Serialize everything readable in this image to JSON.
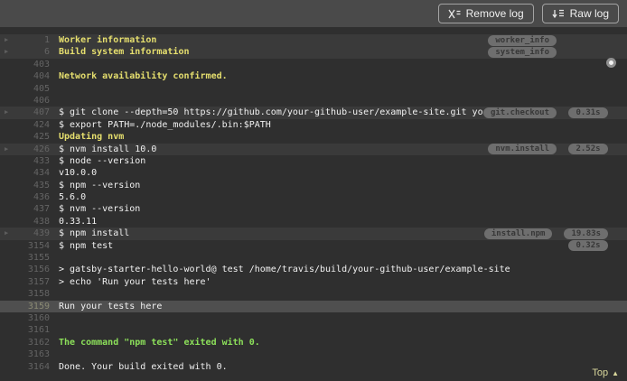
{
  "toolbar": {
    "remove_log_label": "Remove log",
    "raw_log_label": "Raw log"
  },
  "colors": {
    "header_bg": "#4a4a4a",
    "log_bg": "#2f2f2f",
    "row_highlight": "#3a3a3a",
    "row_selected": "#4f4f4f",
    "text_yellow": "#e6df6e",
    "text_green": "#8ce05a",
    "text_default": "#f1f1f1",
    "pill_bg": "#6e6e6e",
    "top_link": "#d9d79c"
  },
  "log": {
    "top_link_label": "Top",
    "rows": [
      {
        "line": "1",
        "text": "Worker information",
        "color": "yellow",
        "fold": true,
        "highlight": true,
        "tag": "worker_info"
      },
      {
        "line": "6",
        "text": "Build system information",
        "color": "yellow",
        "fold": true,
        "highlight": true,
        "tag": "system_info"
      },
      {
        "line": "403",
        "text": ""
      },
      {
        "line": "404",
        "text": "Network availability confirmed.",
        "color": "yellow"
      },
      {
        "line": "405",
        "text": ""
      },
      {
        "line": "406",
        "text": ""
      },
      {
        "line": "407",
        "text": "$ git clone --depth=50 https://github.com/your-github-user/example-site.git your-github-user/example-",
        "fold": true,
        "highlight": true,
        "tag": "git.checkout",
        "duration": "0.31s"
      },
      {
        "line": "424",
        "text": "$ export PATH=./node_modules/.bin:$PATH"
      },
      {
        "line": "425",
        "text": "Updating nvm",
        "color": "yellow"
      },
      {
        "line": "426",
        "text": "$ nvm install 10.0",
        "fold": true,
        "highlight": true,
        "tag": "nvm.install",
        "duration": "2.52s"
      },
      {
        "line": "433",
        "text": "$ node --version"
      },
      {
        "line": "434",
        "text": "v10.0.0"
      },
      {
        "line": "435",
        "text": "$ npm --version"
      },
      {
        "line": "436",
        "text": "5.6.0"
      },
      {
        "line": "437",
        "text": "$ nvm --version"
      },
      {
        "line": "438",
        "text": "0.33.11"
      },
      {
        "line": "439",
        "text": "$ npm install",
        "fold": true,
        "highlight": true,
        "tag": "install.npm",
        "duration": "19.83s"
      },
      {
        "line": "3154",
        "text": "$ npm test",
        "duration": "0.32s"
      },
      {
        "line": "3155",
        "text": ""
      },
      {
        "line": "3156",
        "text": "> gatsby-starter-hello-world@ test /home/travis/build/your-github-user/example-site"
      },
      {
        "line": "3157",
        "text": "> echo 'Run your tests here'"
      },
      {
        "line": "3158",
        "text": ""
      },
      {
        "line": "3159",
        "text": "Run your tests here",
        "selected": true
      },
      {
        "line": "3160",
        "text": ""
      },
      {
        "line": "3161",
        "text": ""
      },
      {
        "line": "3162",
        "text": "The command \"npm test\" exited with 0.",
        "color": "green"
      },
      {
        "line": "3163",
        "text": ""
      },
      {
        "line": "3164",
        "text": "Done. Your build exited with 0."
      }
    ]
  }
}
